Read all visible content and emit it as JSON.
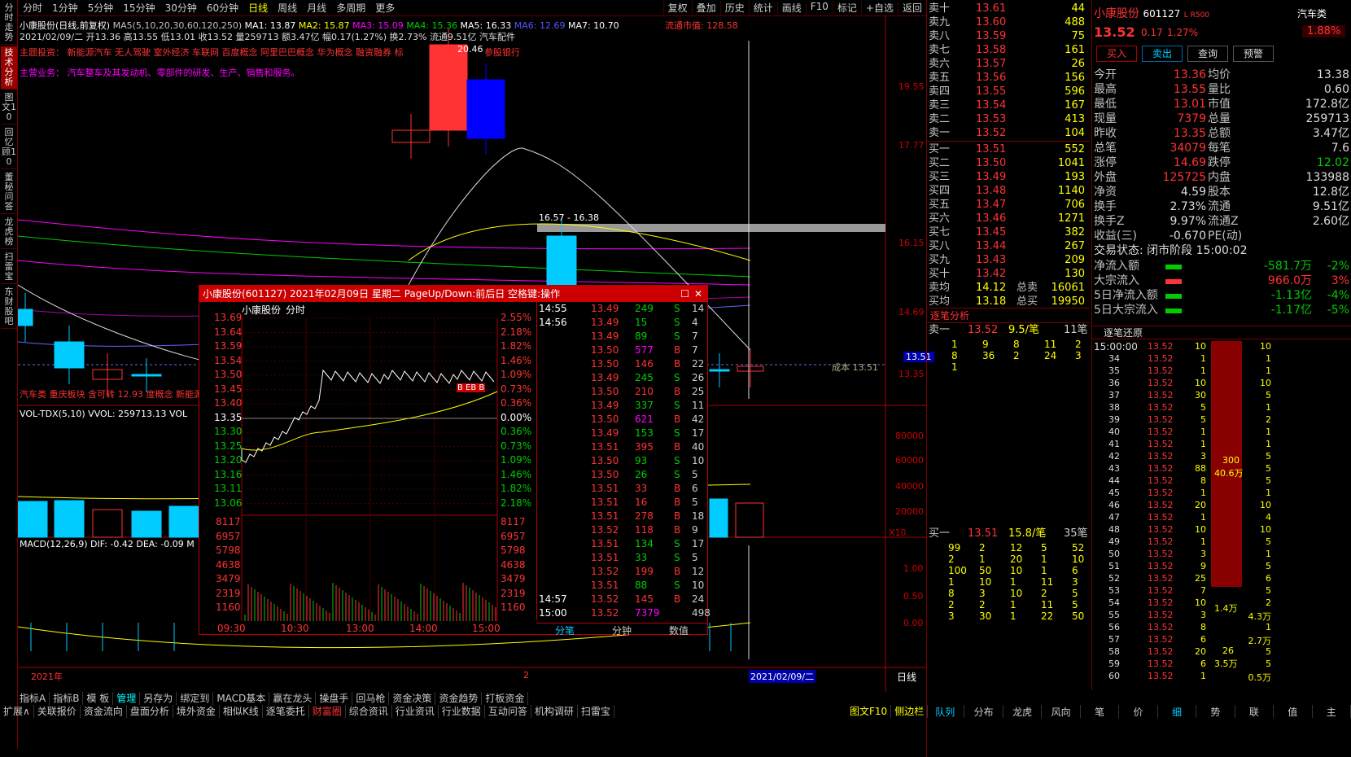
{
  "left_tabs": [
    "分时走势",
    "技术分析",
    "图文10",
    "回忆顾10",
    "董秘问答",
    "龙虎榜",
    "扫雷宝",
    "东财股吧"
  ],
  "period_tabs": [
    "分时",
    "1分钟",
    "5分钟",
    "15分钟",
    "30分钟",
    "60分钟",
    "日线",
    "周线",
    "月线",
    "多周期",
    "更多"
  ],
  "right_tools": [
    "复权",
    "叠加",
    "历史",
    "统计",
    "画线",
    "F10",
    "标记",
    "+自选",
    "返回"
  ],
  "info": {
    "line1": "小康股份(日线,前复权)",
    "ma": [
      "MA5(5,10,20,30,60,120,250)",
      "MA1: 13.87",
      "MA2: 15.87",
      "MA3: 15.09",
      "MA4: 15.36",
      "MA5: 16.33",
      "MA6: 12.69",
      "MA7: 10.70"
    ],
    "float_mv": "流通市值: 128.58",
    "line2": "2021/02/09/二 开13.36 高13.55 低13.01 收13.52 量259713 额3.47亿 幅0.17(1.27%) 换2.73% 流通9.51亿 汽车配件",
    "investment": "主题投资：  新能源汽车  无人驾驶  室外经济  车联网  百度概念  阿里巴巴概念  华为概念  融资融券  标",
    "business": "主营业务：  汽车整车及其发动机、零部件的研发、生产、销售和服务。",
    "price_hi_label": "20.46",
    "range_label": "16.57 - 16.38",
    "cost_label": "成本 13.51",
    "tags_line": "汽车类 重庆板块 含可转 12.93 度概念 新能源车",
    "reg_bank": "参股银行"
  },
  "price_axis": [
    "19.55",
    "17.77",
    "16.15",
    "14.69",
    "13.51",
    "13.35"
  ],
  "vol_label": "VOL-TDX(5,10)  VVOL: 259713.13  VOL",
  "vol_axis": [
    "80000",
    "60000",
    "40000",
    "20000",
    "X10"
  ],
  "macd_label": "MACD(12,26,9)  DIF: -0.42  DEA: -0.09  M",
  "macd_axis": [
    "1.00",
    "0.50",
    "0.00"
  ],
  "x_dates": [
    "2021年",
    "2",
    "2021/02/09/二"
  ],
  "day_label": "日线",
  "popup": {
    "title": "小康股份(601127) 2021年02月09日 星期二 PageUp/Down:前后日 空格键:操作",
    "sub": [
      "小康股份",
      "分时"
    ],
    "price_ticks": [
      "13.69",
      "13.64",
      "13.59",
      "13.54",
      "13.50",
      "13.45",
      "13.40",
      "13.35",
      "13.30",
      "13.25",
      "13.20",
      "13.16",
      "13.11",
      "13.06"
    ],
    "pct_ticks": [
      "2.55%",
      "2.18%",
      "1.82%",
      "1.46%",
      "1.09%",
      "0.73%",
      "0.36%",
      "0.00%",
      "0.36%",
      "0.73%",
      "1.09%",
      "1.46%",
      "1.82%",
      "2.18%"
    ],
    "vol_ticks": [
      "8117",
      "6957",
      "5798",
      "4638",
      "3479",
      "2319",
      "1160"
    ],
    "times": [
      "09:30",
      "10:30",
      "13:00",
      "14:00",
      "15:00"
    ],
    "trades": [
      [
        "14:55",
        "13.49",
        "249",
        "S",
        "14"
      ],
      [
        "14:56",
        "13.49",
        "15",
        "S",
        "4"
      ],
      [
        "",
        "13.49",
        "89",
        "S",
        "7"
      ],
      [
        "",
        "13.50",
        "577",
        "B",
        "7"
      ],
      [
        "",
        "13.50",
        "146",
        "B",
        "22"
      ],
      [
        "",
        "13.49",
        "245",
        "S",
        "26"
      ],
      [
        "",
        "13.50",
        "210",
        "B",
        "25"
      ],
      [
        "",
        "13.49",
        "337",
        "S",
        "11"
      ],
      [
        "",
        "13.50",
        "621",
        "B",
        "42"
      ],
      [
        "",
        "13.49",
        "153",
        "S",
        "17"
      ],
      [
        "",
        "13.51",
        "395",
        "B",
        "40"
      ],
      [
        "",
        "13.50",
        "93",
        "S",
        "10"
      ],
      [
        "",
        "13.50",
        "26",
        "S",
        "5"
      ],
      [
        "",
        "13.51",
        "33",
        "B",
        "6"
      ],
      [
        "",
        "13.51",
        "16",
        "B",
        "5"
      ],
      [
        "",
        "13.51",
        "278",
        "B",
        "18"
      ],
      [
        "",
        "13.52",
        "118",
        "B",
        "9"
      ],
      [
        "",
        "13.51",
        "134",
        "S",
        "17"
      ],
      [
        "",
        "13.51",
        "33",
        "S",
        "5"
      ],
      [
        "",
        "13.52",
        "199",
        "B",
        "12"
      ],
      [
        "",
        "13.51",
        "88",
        "S",
        "10"
      ],
      [
        "14:57",
        "13.52",
        "145",
        "B",
        "24"
      ],
      [
        "15:00",
        "13.52",
        "7379",
        "",
        "498"
      ]
    ],
    "bottom_tabs": [
      "分笔",
      "分钟",
      "数值"
    ],
    "markers": "B EB B"
  },
  "quote": {
    "name": "小康股份",
    "code": "601127",
    "tag": "L R500",
    "price": "13.52",
    "chg": "0.17",
    "pct": "1.27%",
    "sector": "汽车类",
    "sector_pct": "1.88%",
    "buttons": [
      "买入",
      "卖出",
      "查询",
      "预警"
    ],
    "asks": [
      [
        "卖十",
        "13.61",
        "44"
      ],
      [
        "卖九",
        "13.60",
        "488"
      ],
      [
        "卖八",
        "13.59",
        "75"
      ],
      [
        "卖七",
        "13.58",
        "161"
      ],
      [
        "卖六",
        "13.57",
        "26"
      ],
      [
        "卖五",
        "13.56",
        "156"
      ],
      [
        "卖四",
        "13.55",
        "596"
      ],
      [
        "卖三",
        "13.54",
        "167"
      ],
      [
        "卖二",
        "13.53",
        "413"
      ],
      [
        "卖一",
        "13.52",
        "104"
      ]
    ],
    "bids": [
      [
        "买一",
        "13.51",
        "552"
      ],
      [
        "买二",
        "13.50",
        "1041"
      ],
      [
        "买三",
        "13.49",
        "193"
      ],
      [
        "买四",
        "13.48",
        "1140"
      ],
      [
        "买五",
        "13.47",
        "706"
      ],
      [
        "买六",
        "13.46",
        "1271"
      ],
      [
        "买七",
        "13.45",
        "382"
      ],
      [
        "买八",
        "13.44",
        "267"
      ],
      [
        "买九",
        "13.43",
        "209"
      ],
      [
        "买十",
        "13.42",
        "130"
      ]
    ],
    "avg": [
      [
        "卖均",
        "14.12",
        "总卖",
        "16061"
      ],
      [
        "买均",
        "13.18",
        "总买",
        "19950"
      ]
    ],
    "stats": [
      [
        "今开",
        "13.36",
        "均价",
        "13.38"
      ],
      [
        "最高",
        "13.55",
        "量比",
        "0.60"
      ],
      [
        "最低",
        "13.01",
        "市值",
        "172.8亿"
      ],
      [
        "现量",
        "7379",
        "总量",
        "259713"
      ],
      [
        "昨收",
        "13.35",
        "总额",
        "3.47亿"
      ],
      [
        "总笔",
        "34079",
        "每笔",
        "7.6"
      ],
      [
        "涨停",
        "14.69",
        "跌停",
        "12.02"
      ],
      [
        "外盘",
        "125725",
        "内盘",
        "133988"
      ],
      [
        "净资",
        "4.59",
        "股本",
        "12.8亿"
      ],
      [
        "换手",
        "2.73%",
        "流通",
        "9.51亿"
      ],
      [
        "换手Z",
        "9.97%",
        "流通Z",
        "2.60亿"
      ],
      [
        "收益(三)",
        "-0.670",
        "PE(动)",
        ""
      ]
    ],
    "trade_status": "交易状态: 闭市阶段 15:00:02",
    "flows": [
      [
        "净流入额",
        "-581.7万",
        "-2%"
      ],
      [
        "大宗流入",
        "966.0万",
        "3%"
      ],
      [
        "5日净流入额",
        "-1.13亿",
        "-4%"
      ],
      [
        "5日大宗流入",
        "-1.17亿",
        "-5%"
      ]
    ]
  },
  "tick_analysis": {
    "title": "逐笔分析",
    "sell": [
      "卖一",
      "13.52",
      "9.5/笔",
      "11笔"
    ],
    "sell_rows": [
      [
        "1",
        "9",
        "8",
        "11",
        "2"
      ],
      [
        "8",
        "36",
        "2",
        "24",
        "3"
      ],
      [
        "1",
        "",
        "",
        "",
        ""
      ]
    ],
    "buy": [
      "买一",
      "13.51",
      "15.8/笔",
      "35笔"
    ],
    "buy_rows": [
      [
        "99",
        "2",
        "12",
        "5",
        "52"
      ],
      [
        "2",
        "1",
        "20",
        "1",
        "10"
      ],
      [
        "100",
        "50",
        "10",
        "1",
        "6"
      ],
      [
        "1",
        "10",
        "1",
        "11",
        "3"
      ],
      [
        "8",
        "3",
        "10",
        "2",
        "5"
      ],
      [
        "2",
        "2",
        "1",
        "11",
        "5"
      ],
      [
        "3",
        "30",
        "1",
        "22",
        "50"
      ]
    ]
  },
  "tick_restore": {
    "title": "逐笔还原",
    "first": "15:00:00",
    "rows": [
      [
        "",
        "13.52",
        "10"
      ],
      [
        "34",
        "13.52",
        "1"
      ],
      [
        "35",
        "13.52",
        "1"
      ],
      [
        "36",
        "13.52",
        "10"
      ],
      [
        "37",
        "13.52",
        "30"
      ],
      [
        "38",
        "13.52",
        "5"
      ],
      [
        "39",
        "13.52",
        "5"
      ],
      [
        "40",
        "13.52",
        "1"
      ],
      [
        "41",
        "13.52",
        "1"
      ],
      [
        "42",
        "13.52",
        "3"
      ],
      [
        "43",
        "13.52",
        "88"
      ],
      [
        "44",
        "13.52",
        "8"
      ],
      [
        "45",
        "13.52",
        "1"
      ],
      [
        "46",
        "13.52",
        "20"
      ],
      [
        "47",
        "13.52",
        "1"
      ],
      [
        "48",
        "13.52",
        "10"
      ],
      [
        "49",
        "13.52",
        "1"
      ],
      [
        "50",
        "13.52",
        "3"
      ],
      [
        "51",
        "13.52",
        "9"
      ],
      [
        "52",
        "13.52",
        "25"
      ],
      [
        "53",
        "13.52",
        "7"
      ],
      [
        "54",
        "13.52",
        "10"
      ],
      [
        "55",
        "13.52",
        "3"
      ],
      [
        "56",
        "13.52",
        "8"
      ],
      [
        "57",
        "13.52",
        "6"
      ],
      [
        "58",
        "13.52",
        "20"
      ],
      [
        "59",
        "13.52",
        "6"
      ],
      [
        "60",
        "13.52",
        "1"
      ]
    ],
    "side": [
      [
        "10"
      ],
      [
        "1"
      ],
      [
        "1"
      ],
      [
        "10"
      ],
      [
        "5"
      ],
      [
        "1"
      ],
      [
        "2"
      ],
      [
        "1"
      ],
      [
        "1"
      ],
      [
        "5"
      ],
      [
        "5"
      ],
      [
        "5"
      ],
      [
        "1"
      ],
      [
        "10"
      ],
      [
        "4"
      ],
      [
        "10"
      ],
      [
        "5"
      ],
      [
        "1"
      ],
      [
        "5"
      ],
      [
        "6"
      ],
      [
        "5"
      ],
      [
        "2"
      ],
      [
        "4.3万"
      ],
      [
        "1"
      ],
      [
        "2.7万"
      ],
      [
        "5"
      ],
      [
        "5"
      ],
      [
        "0.5万"
      ]
    ],
    "bar_labels": [
      "300",
      "40.6万",
      "1.4万",
      "26",
      "3.5万"
    ]
  },
  "bottom_row1": [
    "指标A",
    "指标B",
    "模 板",
    "管理",
    "另存为",
    "绑定到",
    "MACD基本",
    "赢在龙头",
    "操盘手",
    "回马枪",
    "资金决策",
    "资金趋势",
    "打板资金"
  ],
  "bottom_row2": [
    "扩展∧",
    "关联报价",
    "资金流向",
    "盘面分析",
    "境外资金",
    "相似K线",
    "逐笔委托",
    "财富圈",
    "综合资讯",
    "行业资讯",
    "行业数据",
    "互动问答",
    "机构调研",
    "扫雷宝"
  ],
  "bottom_right": [
    "图文F10",
    "侧边栏"
  ],
  "right_tabs": [
    "队列",
    "分布",
    "龙虎",
    "风向",
    "笔",
    "价",
    "细",
    "势",
    "联",
    "值",
    "主"
  ]
}
